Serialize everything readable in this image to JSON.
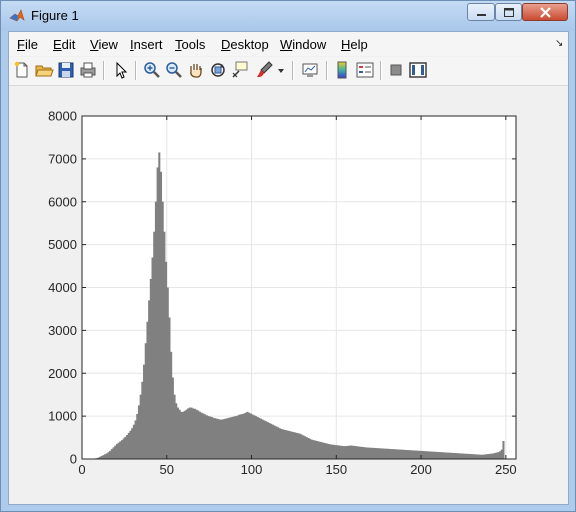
{
  "window": {
    "title": "Figure 1"
  },
  "menu": [
    {
      "id": "file",
      "label": "File",
      "underline": "F",
      "rest": "ile"
    },
    {
      "id": "edit",
      "label": "Edit",
      "underline": "E",
      "rest": "dit"
    },
    {
      "id": "view",
      "label": "View",
      "underline": "V",
      "rest": "iew"
    },
    {
      "id": "insert",
      "label": "Insert",
      "underline": "I",
      "rest": "nsert"
    },
    {
      "id": "tools",
      "label": "Tools",
      "underline": "T",
      "rest": "ools"
    },
    {
      "id": "desktop",
      "label": "Desktop",
      "underline": "D",
      "rest": "esktop"
    },
    {
      "id": "window",
      "label": "Window",
      "underline": "W",
      "rest": "indow"
    },
    {
      "id": "help",
      "label": "Help",
      "underline": "H",
      "rest": "elp"
    }
  ],
  "menu_text": {
    "file_u": "F",
    "file_r": "ile",
    "edit_u": "E",
    "edit_r": "dit",
    "view_u": "V",
    "view_r": "iew",
    "insert_u": "I",
    "insert_r": "nsert",
    "tools_u": "T",
    "tools_r": "ools",
    "desktop_u": "D",
    "desktop_r": "esktop",
    "window_u": "W",
    "window_r": "indow",
    "help_u": "H",
    "help_r": "elp"
  },
  "toolbar_icons": [
    "new-figure-icon",
    "open-file-icon",
    "save-icon",
    "print-icon",
    "edit-plot-arrow-icon",
    "zoom-in-icon",
    "zoom-out-icon",
    "pan-hand-icon",
    "rotate-3d-icon",
    "data-cursor-icon",
    "brush-icon",
    "link-plot-icon",
    "colorbar-icon",
    "legend-icon",
    "hide-plot-tools-icon",
    "show-plot-tools-icon"
  ],
  "chart_data": {
    "type": "bar",
    "title": "",
    "xlabel": "",
    "ylabel": "",
    "xlim": [
      0,
      255
    ],
    "ylim": [
      0,
      8000
    ],
    "xticks": [
      0,
      50,
      100,
      150,
      200,
      250
    ],
    "yticks": [
      0,
      1000,
      2000,
      3000,
      4000,
      5000,
      6000,
      7000,
      8000
    ],
    "grid": true,
    "bar_color": "#808080",
    "x": [
      0,
      1,
      2,
      3,
      4,
      5,
      6,
      7,
      8,
      9,
      10,
      11,
      12,
      13,
      14,
      15,
      16,
      17,
      18,
      19,
      20,
      21,
      22,
      23,
      24,
      25,
      26,
      27,
      28,
      29,
      30,
      31,
      32,
      33,
      34,
      35,
      36,
      37,
      38,
      39,
      40,
      41,
      42,
      43,
      44,
      45,
      46,
      47,
      48,
      49,
      50,
      51,
      52,
      53,
      54,
      55,
      56,
      57,
      58,
      59,
      60,
      61,
      62,
      63,
      64,
      65,
      66,
      67,
      68,
      69,
      70,
      71,
      72,
      73,
      74,
      75,
      76,
      77,
      78,
      79,
      80,
      81,
      82,
      83,
      84,
      85,
      86,
      87,
      88,
      89,
      90,
      91,
      92,
      93,
      94,
      95,
      96,
      97,
      98,
      99,
      100,
      101,
      102,
      103,
      104,
      105,
      106,
      107,
      108,
      109,
      110,
      111,
      112,
      113,
      114,
      115,
      116,
      117,
      118,
      119,
      120,
      121,
      122,
      123,
      124,
      125,
      126,
      127,
      128,
      129,
      130,
      131,
      132,
      133,
      134,
      135,
      136,
      137,
      138,
      139,
      140,
      141,
      142,
      143,
      144,
      145,
      146,
      147,
      148,
      149,
      150,
      151,
      152,
      153,
      154,
      155,
      156,
      157,
      158,
      159,
      160,
      161,
      162,
      163,
      164,
      165,
      166,
      167,
      168,
      169,
      170,
      171,
      172,
      173,
      174,
      175,
      176,
      177,
      178,
      179,
      180,
      181,
      182,
      183,
      184,
      185,
      186,
      187,
      188,
      189,
      190,
      191,
      192,
      193,
      194,
      195,
      196,
      197,
      198,
      199,
      200,
      201,
      202,
      203,
      204,
      205,
      206,
      207,
      208,
      209,
      210,
      211,
      212,
      213,
      214,
      215,
      216,
      217,
      218,
      219,
      220,
      221,
      222,
      223,
      224,
      225,
      226,
      227,
      228,
      229,
      230,
      231,
      232,
      233,
      234,
      235,
      236,
      237,
      238,
      239,
      240,
      241,
      242,
      243,
      244,
      245,
      246,
      247,
      248,
      249,
      250,
      251,
      252,
      253,
      254,
      255
    ],
    "values": [
      0,
      0,
      0,
      0,
      0,
      0,
      0,
      10,
      20,
      30,
      50,
      70,
      90,
      110,
      130,
      160,
      190,
      230,
      270,
      310,
      350,
      380,
      410,
      440,
      480,
      520,
      560,
      610,
      660,
      720,
      800,
      900,
      1050,
      1250,
      1500,
      1800,
      2200,
      2700,
      3200,
      3700,
      4200,
      4700,
      5300,
      6000,
      6800,
      7150,
      6700,
      6000,
      5300,
      4600,
      4000,
      3300,
      2500,
      1900,
      1500,
      1300,
      1200,
      1150,
      1100,
      1100,
      1120,
      1150,
      1180,
      1200,
      1200,
      1180,
      1170,
      1150,
      1130,
      1100,
      1080,
      1060,
      1040,
      1020,
      1000,
      990,
      980,
      960,
      950,
      940,
      930,
      920,
      920,
      930,
      940,
      950,
      960,
      970,
      980,
      990,
      1000,
      1010,
      1030,
      1040,
      1050,
      1060,
      1080,
      1100,
      1080,
      1060,
      1040,
      1020,
      1000,
      980,
      960,
      940,
      920,
      900,
      880,
      860,
      840,
      820,
      800,
      780,
      760,
      740,
      720,
      700,
      690,
      680,
      670,
      660,
      650,
      640,
      630,
      620,
      610,
      600,
      590,
      570,
      550,
      530,
      510,
      490,
      470,
      450,
      440,
      430,
      420,
      410,
      400,
      390,
      380,
      370,
      360,
      350,
      340,
      335,
      330,
      325,
      320,
      315,
      310,
      305,
      300,
      300,
      305,
      310,
      315,
      310,
      305,
      300,
      295,
      290,
      285,
      280,
      275,
      270,
      268,
      265,
      262,
      260,
      258,
      255,
      252,
      250,
      248,
      245,
      242,
      240,
      238,
      235,
      232,
      230,
      228,
      225,
      222,
      220,
      218,
      215,
      212,
      210,
      208,
      205,
      202,
      200,
      198,
      195,
      192,
      190,
      188,
      185,
      182,
      180,
      178,
      175,
      172,
      170,
      168,
      165,
      162,
      160,
      158,
      155,
      152,
      150,
      148,
      145,
      142,
      140,
      138,
      135,
      132,
      130,
      128,
      125,
      122,
      120,
      118,
      115,
      112,
      110,
      108,
      105,
      102,
      100,
      100,
      105,
      110,
      115,
      120,
      125,
      130,
      140,
      150,
      160,
      180,
      220,
      420
    ]
  }
}
